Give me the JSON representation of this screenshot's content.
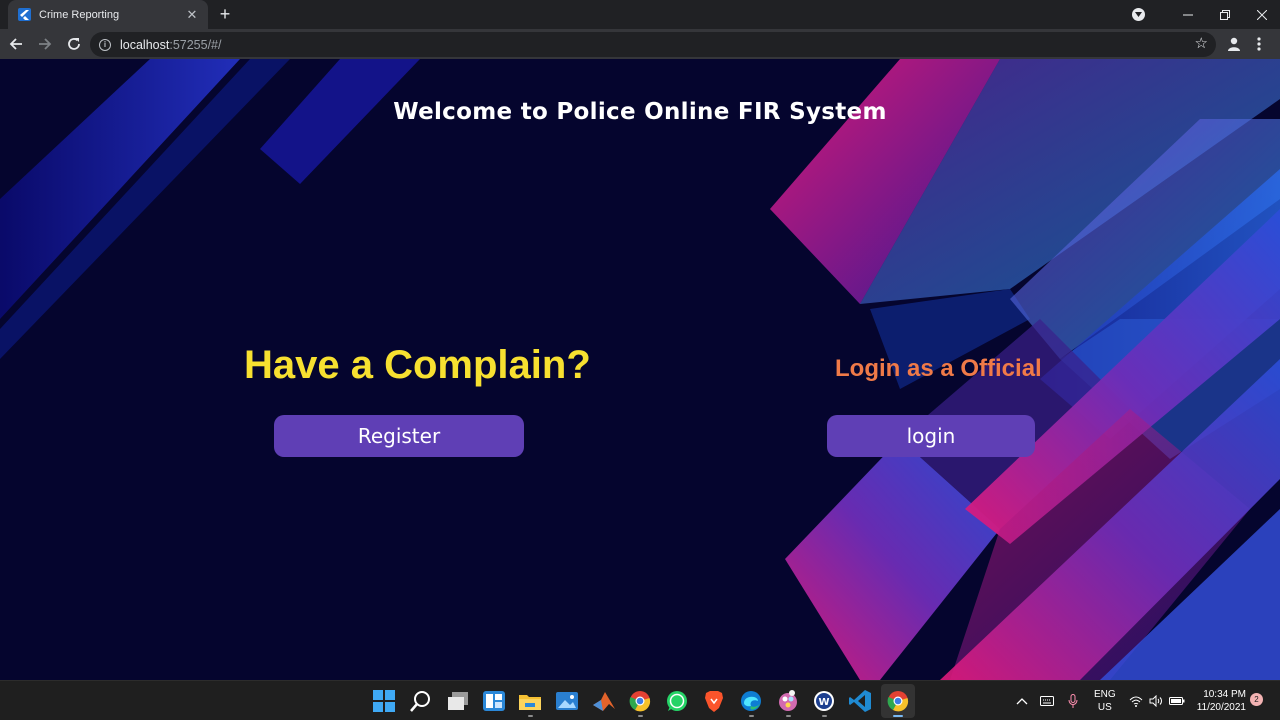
{
  "browser": {
    "tab_title": "Crime Reporting",
    "url_host": "localhost",
    "url_rest": ":57255/#/"
  },
  "page": {
    "welcome": "Welcome to Police Online FIR System",
    "complain_heading": "Have a Complain?",
    "register_label": "Register",
    "official_heading": "Login as a Official",
    "login_label": "login"
  },
  "colors": {
    "background": "#05052e",
    "complain_heading": "#f7e030",
    "official_heading": "#f07a48",
    "button": "#5f3fb5"
  },
  "taskbar": {
    "apps": [
      "start-icon",
      "search-icon",
      "task-view-icon",
      "widgets-icon",
      "file-explorer-icon",
      "photos-icon",
      "matlab-icon",
      "chrome-icon",
      "whatsapp-icon",
      "brave-icon",
      "edge-icon",
      "color-picker-icon",
      "word-icon",
      "vscode-icon",
      "chrome-active-icon"
    ],
    "lang_top": "ENG",
    "lang_bottom": "US",
    "time": "10:34 PM",
    "date": "11/20/2021",
    "notifications": "2"
  }
}
